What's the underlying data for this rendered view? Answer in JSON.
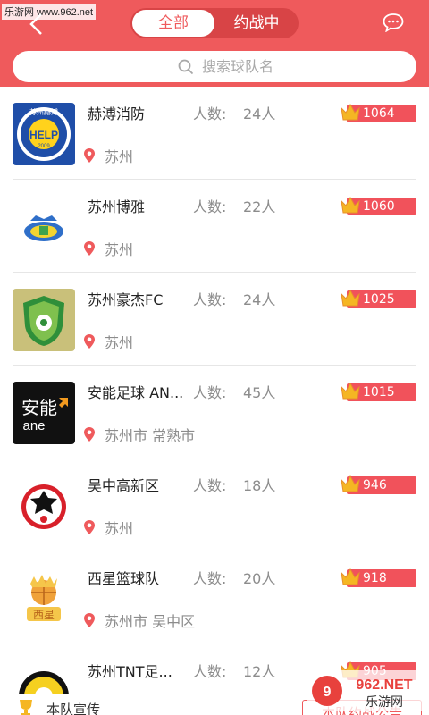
{
  "watermark": "乐游网 www.962.net",
  "tabs": {
    "all": "全部",
    "battle": "约战中"
  },
  "search": {
    "placeholder": "搜索球队名"
  },
  "count_label": "人数:",
  "teams": [
    {
      "name": "赫溥消防",
      "count": "24人",
      "location": "苏州",
      "score": "1064"
    },
    {
      "name": "苏州博雅",
      "count": "22人",
      "location": "苏州",
      "score": "1060"
    },
    {
      "name": "苏州豪杰FC",
      "count": "24人",
      "location": "苏州",
      "score": "1025"
    },
    {
      "name": "安能足球 AN...",
      "count": "45人",
      "location": "苏州市 常熟市",
      "score": "1015"
    },
    {
      "name": "吴中高新区",
      "count": "18人",
      "location": "苏州",
      "score": "946"
    },
    {
      "name": "西星篮球队",
      "count": "20人",
      "location": "苏州市 吴中区",
      "score": "918"
    },
    {
      "name": "苏州TNT足...",
      "count": "12人",
      "location": "",
      "score": "905"
    }
  ],
  "logos": {
    "help": {
      "top": "苏州赫溥",
      "mid": "HELP",
      "year": "2009"
    },
    "ane": {
      "cn": "安能",
      "en": "ane"
    },
    "xixing": "西星"
  },
  "bottom": {
    "text": "本队宣传",
    "button": "本队约战公告"
  },
  "brand": {
    "line1": "962.NET",
    "line2": "乐游网"
  },
  "colors": {
    "accent": "#ef5a5c",
    "score_bar": "#f1525b"
  }
}
